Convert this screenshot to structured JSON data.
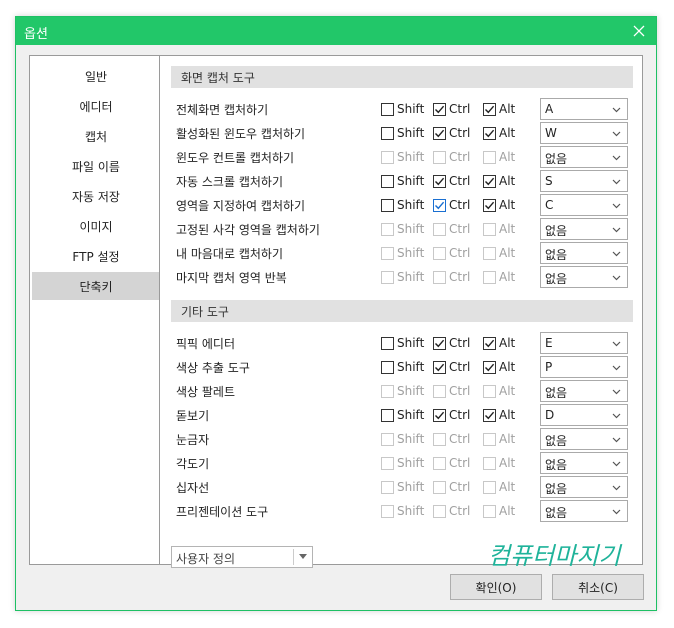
{
  "window": {
    "title": "옵션"
  },
  "nav": {
    "items": [
      {
        "label": "일반"
      },
      {
        "label": "에디터"
      },
      {
        "label": "캡처"
      },
      {
        "label": "파일 이름"
      },
      {
        "label": "자동 저장"
      },
      {
        "label": "이미지"
      },
      {
        "label": "FTP 설정"
      },
      {
        "label": "단축키",
        "selected": true
      }
    ]
  },
  "modifiers": {
    "shift": "Shift",
    "ctrl": "Ctrl",
    "alt": "Alt"
  },
  "sections": [
    {
      "title": "화면 캡처 도구",
      "rows": [
        {
          "label": "전체화면 캡처하기",
          "enabled": true,
          "shift": false,
          "ctrl": true,
          "alt": true,
          "key": "A"
        },
        {
          "label": "활성화된 윈도우 캡처하기",
          "enabled": true,
          "shift": false,
          "ctrl": true,
          "alt": true,
          "key": "W"
        },
        {
          "label": "윈도우 컨트롤 캡처하기",
          "enabled": false,
          "shift": false,
          "ctrl": false,
          "alt": false,
          "key": "없음"
        },
        {
          "label": "자동 스크롤 캡처하기",
          "enabled": true,
          "shift": false,
          "ctrl": true,
          "alt": true,
          "key": "S"
        },
        {
          "label": "영역을 지정하여 캡처하기",
          "enabled": true,
          "shift": false,
          "ctrl": true,
          "alt": true,
          "key": "C"
        },
        {
          "label": "고정된 사각 영역을 캡처하기",
          "enabled": false,
          "shift": false,
          "ctrl": false,
          "alt": false,
          "key": "없음"
        },
        {
          "label": "내 마음대로 캡처하기",
          "enabled": false,
          "shift": false,
          "ctrl": false,
          "alt": false,
          "key": "없음"
        },
        {
          "label": "마지막 캡처 영역 반복",
          "enabled": false,
          "shift": false,
          "ctrl": false,
          "alt": false,
          "key": "없음"
        }
      ]
    },
    {
      "title": "기타 도구",
      "rows": [
        {
          "label": "픽픽 에디터",
          "enabled": true,
          "shift": false,
          "ctrl": true,
          "alt": true,
          "key": "E"
        },
        {
          "label": "색상 추출 도구",
          "enabled": true,
          "shift": false,
          "ctrl": true,
          "alt": true,
          "key": "P"
        },
        {
          "label": "색상 팔레트",
          "enabled": false,
          "shift": false,
          "ctrl": false,
          "alt": false,
          "key": "없음"
        },
        {
          "label": "돋보기",
          "enabled": true,
          "shift": false,
          "ctrl": true,
          "alt": true,
          "key": "D"
        },
        {
          "label": "눈금자",
          "enabled": false,
          "shift": false,
          "ctrl": false,
          "alt": false,
          "key": "없음"
        },
        {
          "label": "각도기",
          "enabled": false,
          "shift": false,
          "ctrl": false,
          "alt": false,
          "key": "없음"
        },
        {
          "label": "십자선",
          "enabled": false,
          "shift": false,
          "ctrl": false,
          "alt": false,
          "key": "없음"
        },
        {
          "label": "프리젠테이션 도구",
          "enabled": false,
          "shift": false,
          "ctrl": false,
          "alt": false,
          "key": "없음"
        }
      ]
    }
  ],
  "preset": {
    "value": "사용자 정의"
  },
  "watermark": {
    "text": "컴퓨터마지기"
  },
  "buttons": {
    "ok": "확인(O)",
    "cancel": "취소(C)"
  },
  "colors": {
    "accent": "#22c769",
    "selected_nav": "#d4d4d4",
    "section_header": "#e1e1e1"
  }
}
